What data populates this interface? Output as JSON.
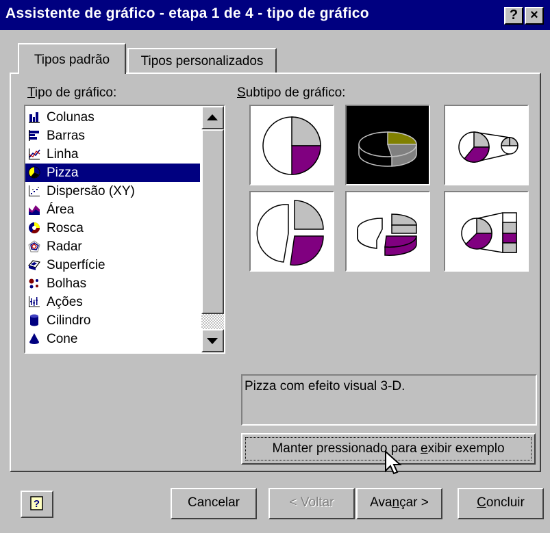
{
  "window": {
    "title": "Assistente de gráfico - etapa 1 de 4 - tipo de gráfico",
    "help_glyph": "?",
    "close_glyph": "×"
  },
  "tabs": [
    {
      "label": "Tipos padrão",
      "active": true
    },
    {
      "label": "Tipos personalizados",
      "active": false
    }
  ],
  "chart_type_list": {
    "label_accel": "T",
    "label_rest": "ipo de gráfico:",
    "selected": "Pizza",
    "items": [
      {
        "label": "Colunas",
        "icon": "column-chart-icon"
      },
      {
        "label": "Barras",
        "icon": "bar-chart-icon"
      },
      {
        "label": "Linha",
        "icon": "line-chart-icon"
      },
      {
        "label": "Pizza",
        "icon": "pie-chart-icon"
      },
      {
        "label": "Dispersão (XY)",
        "icon": "scatter-chart-icon"
      },
      {
        "label": "Área",
        "icon": "area-chart-icon"
      },
      {
        "label": "Rosca",
        "icon": "doughnut-chart-icon"
      },
      {
        "label": "Radar",
        "icon": "radar-chart-icon"
      },
      {
        "label": "Superfície",
        "icon": "surface-chart-icon"
      },
      {
        "label": "Bolhas",
        "icon": "bubble-chart-icon"
      },
      {
        "label": "Ações",
        "icon": "stock-chart-icon"
      },
      {
        "label": "Cilindro",
        "icon": "cylinder-chart-icon"
      },
      {
        "label": "Cone",
        "icon": "cone-chart-icon"
      }
    ]
  },
  "subtype": {
    "label_accel": "S",
    "label_rest": "ubtipo de gráfico:",
    "selected_index": 1,
    "options": [
      {
        "icon": "pie-icon"
      },
      {
        "icon": "pie-3d-icon"
      },
      {
        "icon": "pie-of-pie-icon"
      },
      {
        "icon": "exploded-pie-icon"
      },
      {
        "icon": "exploded-pie-3d-icon"
      },
      {
        "icon": "bar-of-pie-icon"
      }
    ]
  },
  "description": "Pizza com efeito visual 3-D.",
  "preview_button": {
    "before": "Manter pressionado para ",
    "accel": "e",
    "after": "xibir exemplo"
  },
  "buttons": {
    "help_icon": "help-icon",
    "cancel": "Cancelar",
    "back": "< Voltar",
    "next_before": "Ava",
    "next_accel": "n",
    "next_after": "çar >",
    "finish_accel": "C",
    "finish_rest": "oncluir"
  },
  "colors": {
    "title_bar": "#000080",
    "purple_slice": "#800080",
    "olive_slice": "#808000",
    "gray_slice": "#c0c0c0"
  }
}
